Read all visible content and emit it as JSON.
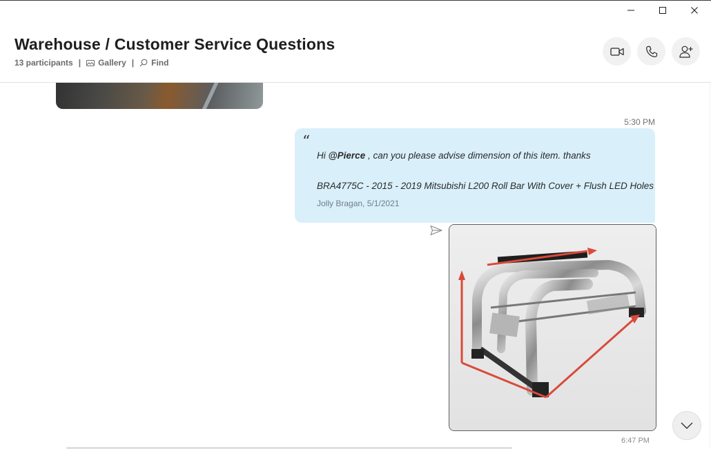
{
  "window": {
    "minimize_icon": "minimize-icon",
    "maximize_icon": "maximize-icon",
    "close_icon": "close-icon"
  },
  "header": {
    "title": "Warehouse / Customer Service Questions",
    "participants": "13 participants",
    "separator": "|",
    "gallery_label": "Gallery",
    "gallery_icon": "image-icon",
    "find_label": "Find",
    "find_icon": "search-icon",
    "actions": [
      "video-call-icon",
      "phone-call-icon",
      "add-person-icon"
    ]
  },
  "messages": [
    {
      "timestamp": "5:30 PM",
      "quote": {
        "prefix": "Hi ",
        "mention": "@Pierce",
        "suffix": " , can you please advise dimension of this item. thanks",
        "line2": "BRA4775C - 2015 - 2019 Mitsubishi L200 Roll Bar With Cover + Flush LED Holes",
        "author": "Jolly Bragan, 5/1/2021"
      },
      "status_icon": "sent-icon"
    }
  ],
  "next_timestamp_partial": "6:47 PM",
  "colors": {
    "bubble": "#d9f0fb",
    "arrow_red": "#d94a3a",
    "header_btn": "#f1f1f1"
  }
}
